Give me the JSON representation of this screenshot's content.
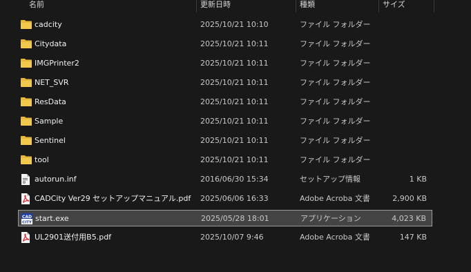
{
  "columns": {
    "name": "名前",
    "date": "更新日時",
    "type": "種類",
    "size": "サイズ"
  },
  "files": [
    {
      "name": "cadcity",
      "date": "2025/10/21 10:10",
      "type": "ファイル フォルダー",
      "size": "",
      "icon": "folder-icon"
    },
    {
      "name": "Citydata",
      "date": "2025/10/21 10:11",
      "type": "ファイル フォルダー",
      "size": "",
      "icon": "folder-icon"
    },
    {
      "name": "IMGPrinter2",
      "date": "2025/10/21 10:11",
      "type": "ファイル フォルダー",
      "size": "",
      "icon": "folder-icon"
    },
    {
      "name": "NET_SVR",
      "date": "2025/10/21 10:11",
      "type": "ファイル フォルダー",
      "size": "",
      "icon": "folder-icon"
    },
    {
      "name": "ResData",
      "date": "2025/10/21 10:11",
      "type": "ファイル フォルダー",
      "size": "",
      "icon": "folder-icon"
    },
    {
      "name": "Sample",
      "date": "2025/10/21 10:11",
      "type": "ファイル フォルダー",
      "size": "",
      "icon": "folder-icon"
    },
    {
      "name": "Sentinel",
      "date": "2025/10/21 10:11",
      "type": "ファイル フォルダー",
      "size": "",
      "icon": "folder-icon"
    },
    {
      "name": "tool",
      "date": "2025/10/21 10:11",
      "type": "ファイル フォルダー",
      "size": "",
      "icon": "folder-icon"
    },
    {
      "name": "autorun.inf",
      "date": "2016/06/30 15:34",
      "type": "セットアップ情報",
      "size": "1 KB",
      "icon": "setup-info-icon"
    },
    {
      "name": "CADCity Ver29 セットアップマニュアル.pdf",
      "date": "2025/06/06 16:33",
      "type": "Adobe Acroba 文書",
      "size": "2,900 KB",
      "icon": "pdf-icon"
    },
    {
      "name": "start.exe",
      "date": "2025/05/28 18:01",
      "type": "アプリケーション",
      "size": "4,023 KB",
      "icon": "cadcity-app-icon",
      "selected": true
    },
    {
      "name": "UL2901送付用B5.pdf",
      "date": "2025/10/07 9:46",
      "type": "Adobe Acroba 文書",
      "size": "147 KB",
      "icon": "pdf-icon"
    }
  ],
  "app_icon_text": "CAD CITY",
  "colors": {
    "folder": "#e8b83c",
    "pdf": "#d42020",
    "selected_bg": "#444444",
    "selected_border": "#9a9a9a"
  }
}
